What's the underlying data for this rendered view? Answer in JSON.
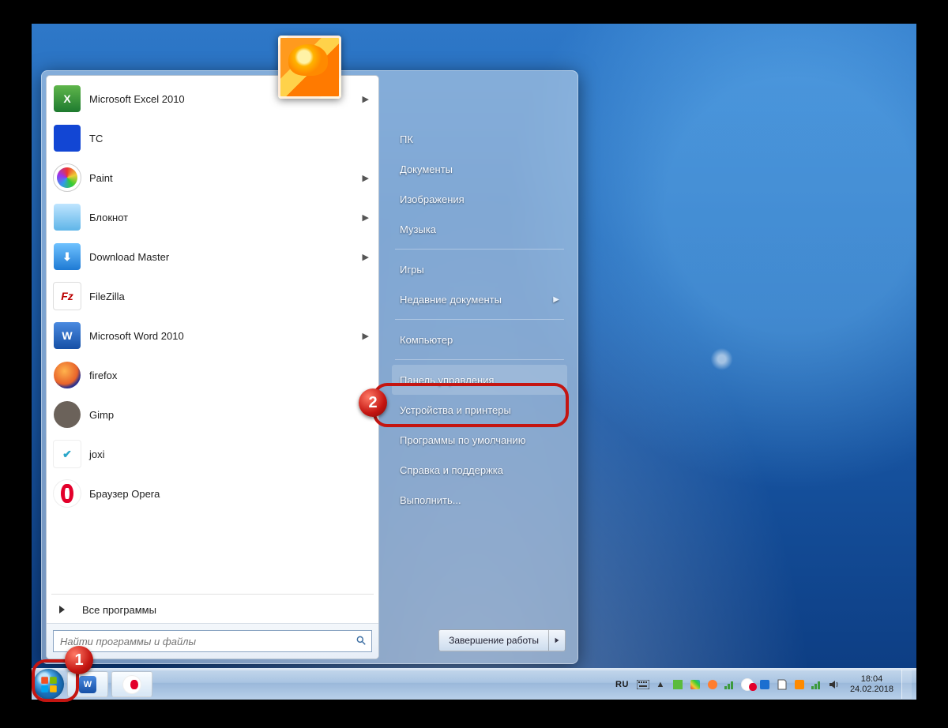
{
  "programs": [
    {
      "label": "Microsoft Excel 2010",
      "arrow": true,
      "icon": "excel"
    },
    {
      "label": "TC",
      "arrow": false,
      "icon": "tc"
    },
    {
      "label": "Paint",
      "arrow": true,
      "icon": "paint"
    },
    {
      "label": "Блокнот",
      "arrow": true,
      "icon": "note"
    },
    {
      "label": "Download Master",
      "arrow": true,
      "icon": "dm"
    },
    {
      "label": "FileZilla",
      "arrow": false,
      "icon": "fz"
    },
    {
      "label": "Microsoft Word 2010",
      "arrow": true,
      "icon": "word"
    },
    {
      "label": "firefox",
      "arrow": false,
      "icon": "ff"
    },
    {
      "label": "Gimp",
      "arrow": false,
      "icon": "gimp"
    },
    {
      "label": "joxi",
      "arrow": false,
      "icon": "joxi"
    },
    {
      "label": "Браузер Opera",
      "arrow": false,
      "icon": "opera"
    }
  ],
  "all_programs": "Все программы",
  "search_placeholder": "Найти программы и файлы",
  "right": [
    {
      "label": "ПК"
    },
    {
      "label": "Документы"
    },
    {
      "label": "Изображения"
    },
    {
      "label": "Музыка"
    },
    {
      "sep": true
    },
    {
      "label": "Игры"
    },
    {
      "label": "Недавние документы",
      "arrow": true
    },
    {
      "sep": true
    },
    {
      "label": "Компьютер"
    },
    {
      "sep": true
    },
    {
      "label": "Панель управления",
      "highlight": true
    },
    {
      "label": "Устройства и принтеры"
    },
    {
      "label": "Программы по умолчанию"
    },
    {
      "label": "Справка и поддержка"
    },
    {
      "label": "Выполнить..."
    }
  ],
  "shutdown": "Завершение работы",
  "tray": {
    "lang": "RU",
    "time": "18:04",
    "date": "24.02.2018"
  },
  "annot": {
    "b1": "1",
    "b2": "2"
  }
}
